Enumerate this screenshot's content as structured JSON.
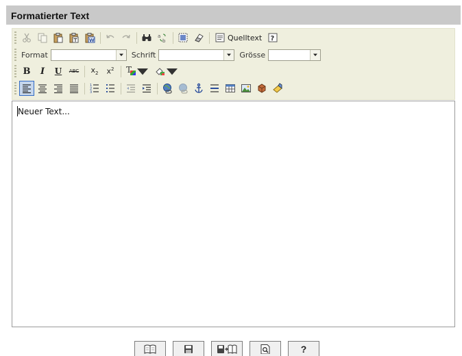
{
  "window": {
    "title": "Formatierter Text"
  },
  "toolbar": {
    "row1": {
      "icons": [
        "cut-icon",
        "copy-icon",
        "paste-icon",
        "paste-text-icon",
        "paste-word-icon",
        "undo-icon",
        "redo-icon",
        "find-icon",
        "replace-icon",
        "select-all-icon",
        "remove-format-icon",
        "source-icon",
        "about-icon"
      ],
      "source_label": "Quelltext"
    },
    "row2": {
      "format_label": "Format",
      "format_value": "",
      "font_label": "Schrift",
      "font_value": "",
      "size_label": "Grösse",
      "size_value": ""
    },
    "row3": {
      "icons": [
        "bold-icon",
        "italic-icon",
        "underline-icon",
        "strikethrough-icon",
        "subscript-icon",
        "superscript-icon",
        "text-color-icon",
        "background-color-icon"
      ],
      "bold_glyph": "B",
      "italic_glyph": "I",
      "underline_glyph": "U",
      "strike_glyph": "ABC",
      "sub_glyph": "x",
      "sup_glyph": "x",
      "text_color_glyph": "T"
    },
    "row4": {
      "icons": [
        "align-left-icon",
        "align-center-icon",
        "align-right-icon",
        "align-justify-icon",
        "ordered-list-icon",
        "unordered-list-icon",
        "outdent-icon",
        "indent-icon",
        "link-icon",
        "unlink-icon",
        "anchor-icon",
        "horizontal-rule-icon",
        "table-icon",
        "image-icon",
        "special-char-icon",
        "flash-icon"
      ]
    }
  },
  "editor": {
    "content": "Neuer Text..."
  },
  "bottom_buttons": [
    {
      "icon": "book-icon",
      "label": ""
    },
    {
      "icon": "save-icon",
      "label": ""
    },
    {
      "icon": "save-and-book-icon",
      "label": ""
    },
    {
      "icon": "preview-icon",
      "label": ""
    },
    {
      "icon": "help-icon",
      "label": "?"
    }
  ],
  "colors": {
    "title_bar": "#c9c9c9",
    "toolbar_bg": "#efefde",
    "active_button": "#c5d6ec",
    "editor_border": "#9a9a9a"
  }
}
